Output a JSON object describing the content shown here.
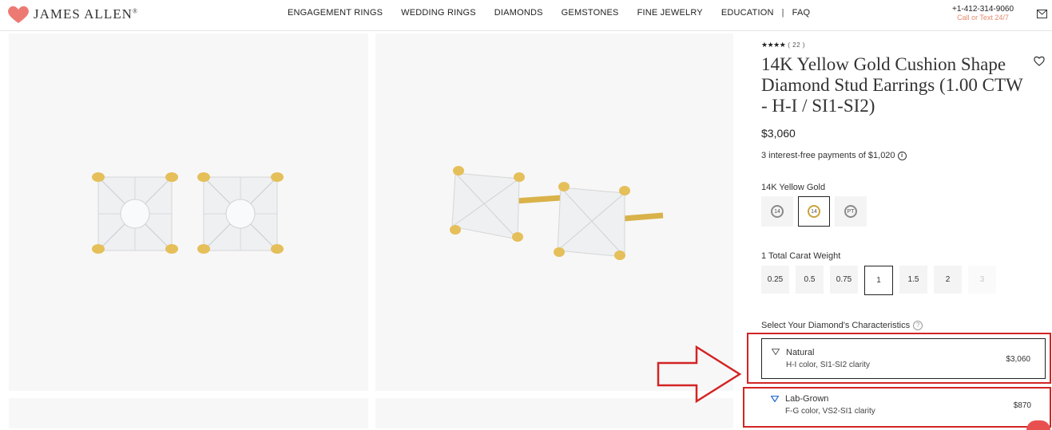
{
  "header": {
    "logo_text": "James Allen",
    "nav": [
      "ENGAGEMENT RINGS",
      "WEDDING RINGS",
      "DIAMONDS",
      "GEMSTONES",
      "FINE JEWELRY",
      "EDUCATION"
    ],
    "nav_separator": "|",
    "nav_faq": "FAQ",
    "phone": "+1-412-314-9060",
    "phone_sub": "Call or Text 24/7"
  },
  "product": {
    "stars": "★★★★",
    "review_count": "( 22 )",
    "title": "14K Yellow Gold Cushion Shape Diamond Stud Earrings (1.00 CTW - H-I / SI1-SI2)",
    "price": "$3,060",
    "installments": "3 interest-free payments of $1,020",
    "metal_label": "14K Yellow Gold",
    "metal_options": [
      {
        "label": "14",
        "selected": false,
        "color": "#8a8a8a"
      },
      {
        "label": "14",
        "selected": true,
        "color": "#c9a33a"
      },
      {
        "label": "PT",
        "selected": false,
        "color": "#8a8a8a"
      }
    ],
    "carat_label": "1 Total Carat Weight",
    "carat_options": [
      {
        "label": "0.25",
        "selected": false,
        "disabled": false
      },
      {
        "label": "0.5",
        "selected": false,
        "disabled": false
      },
      {
        "label": "0.75",
        "selected": false,
        "disabled": false
      },
      {
        "label": "1",
        "selected": true,
        "disabled": false
      },
      {
        "label": "1.5",
        "selected": false,
        "disabled": false
      },
      {
        "label": "2",
        "selected": false,
        "disabled": false
      },
      {
        "label": "3",
        "selected": false,
        "disabled": true
      }
    ],
    "characteristics_label": "Select Your Diamond's Characteristics",
    "diamond_options": [
      {
        "name": "Natural",
        "desc": "H-I color, SI1-SI2 clarity",
        "price": "$3,060",
        "icon_color": "#666666"
      },
      {
        "name": "Lab-Grown",
        "desc": "F-G color, VS2-SI1 clarity",
        "price": "$870",
        "icon_color": "#2f6fd0"
      }
    ]
  },
  "colors": {
    "accent_pink": "#e58a6e",
    "annotation_red": "#d32424",
    "gold": "#d9b24a"
  }
}
